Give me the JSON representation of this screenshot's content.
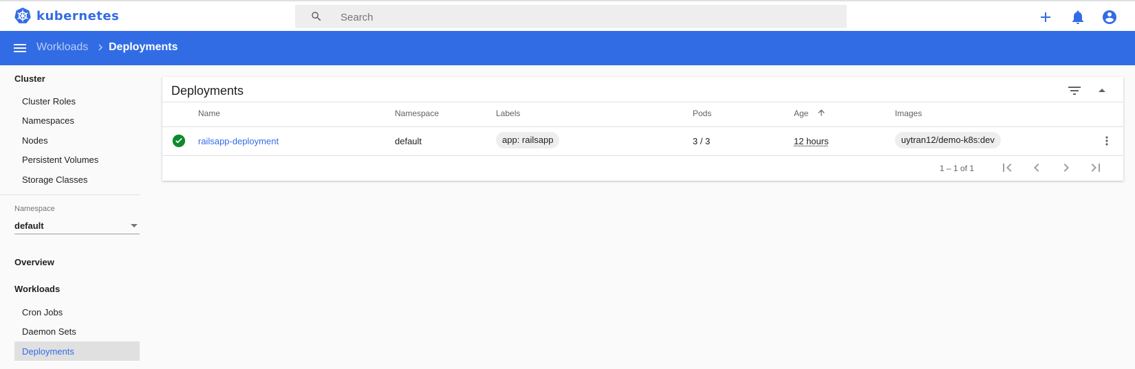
{
  "app": {
    "name": "kubernetes",
    "brand_color": "#326ce5"
  },
  "search": {
    "placeholder": "Search"
  },
  "header_icons": [
    "plus-icon",
    "bell-icon",
    "account-circle-icon"
  ],
  "toolbar": {
    "breadcrumb_parent": "Workloads",
    "breadcrumb_current": "Deployments"
  },
  "sidebar": {
    "cluster_heading": "Cluster",
    "cluster_items": [
      "Cluster Roles",
      "Namespaces",
      "Nodes",
      "Persistent Volumes",
      "Storage Classes"
    ],
    "namespace_label": "Namespace",
    "namespace_value": "default",
    "overview": "Overview",
    "workloads_heading": "Workloads",
    "workload_items": [
      "Cron Jobs",
      "Daemon Sets",
      "Deployments"
    ]
  },
  "card": {
    "title": "Deployments",
    "columns": [
      "Name",
      "Namespace",
      "Labels",
      "Pods",
      "Age",
      "Images"
    ],
    "rows": [
      {
        "status": "ok",
        "name": "railsapp-deployment",
        "namespace": "default",
        "labels": [
          "app: railsapp"
        ],
        "pods": "3 / 3",
        "age": "12 hours",
        "images": [
          "uytran12/demo-k8s:dev"
        ]
      }
    ],
    "pagination": "1 – 1 of 1"
  },
  "colors": {
    "status_ok": "#0d8a2e",
    "toolbar": "#326ce5",
    "sidebar_active": "#e0e0e0"
  }
}
